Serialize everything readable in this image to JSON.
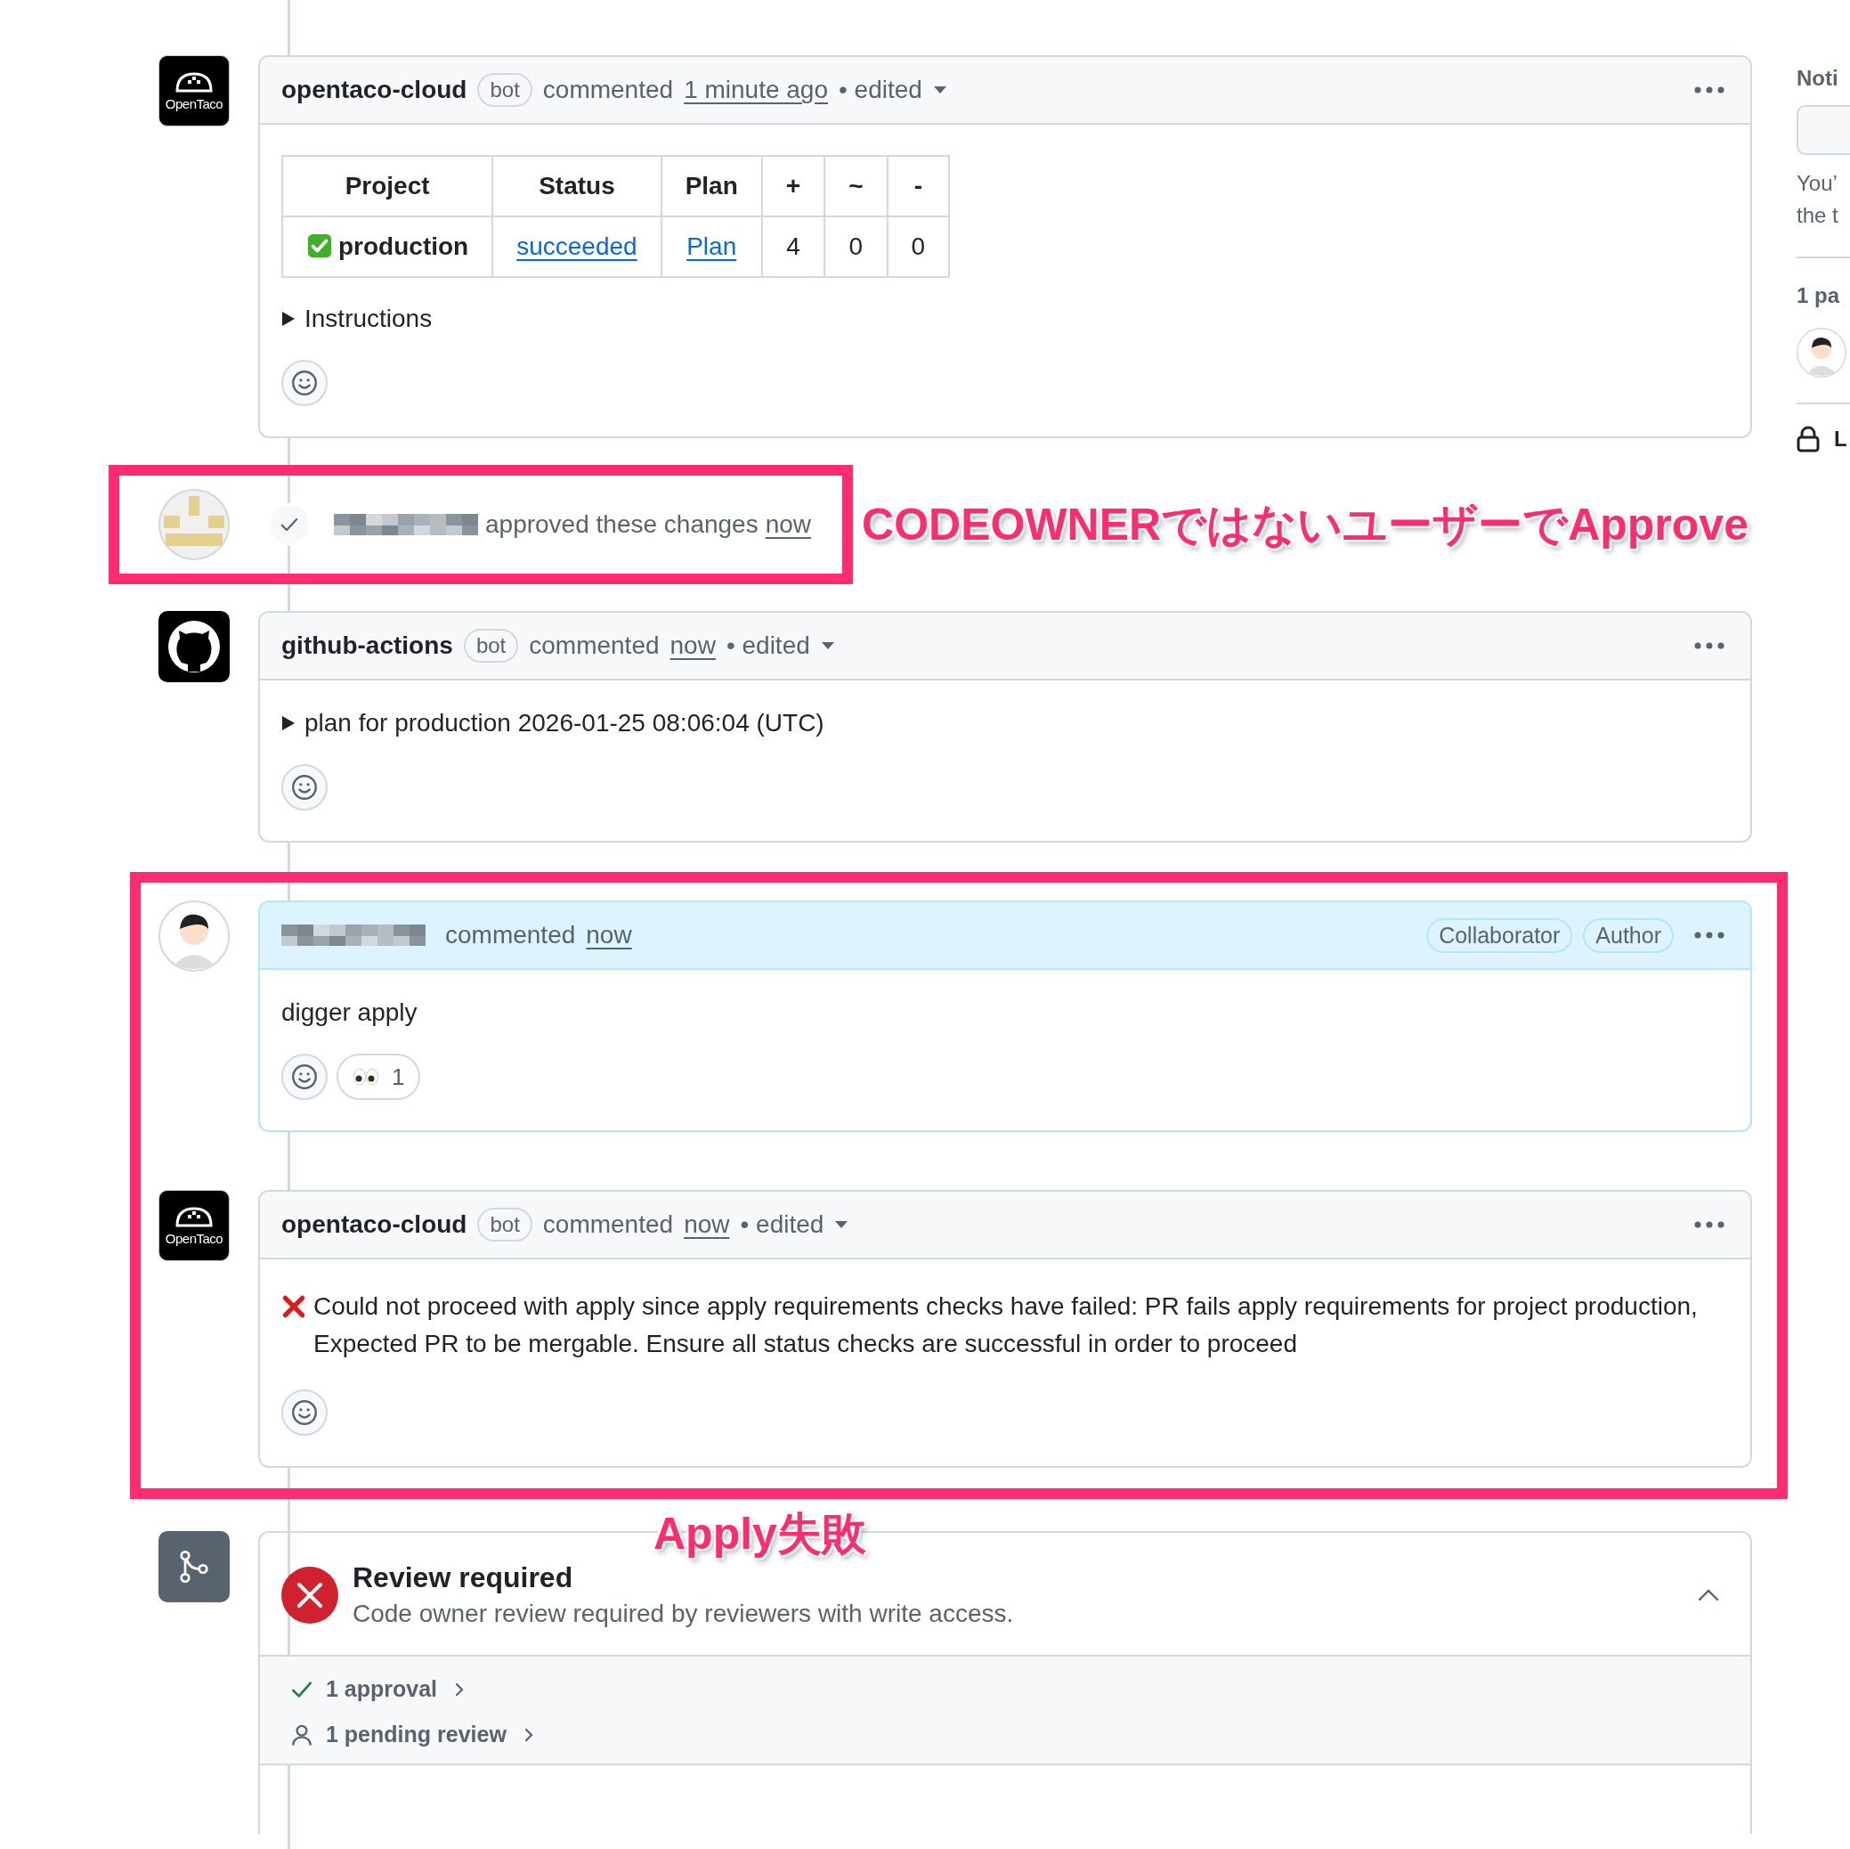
{
  "timeline": [
    {
      "kind": "comment",
      "avatar": {
        "kind": "logo",
        "text": "OpenTaco"
      },
      "author": "opentaco-cloud",
      "badge": "bot",
      "action": "commented",
      "time": "1 minute ago",
      "edited": "• edited",
      "highlighted": false,
      "body": [
        {
          "kind": "table",
          "columns": [
            "Project",
            "Status",
            "Plan",
            "+",
            "~",
            "-"
          ],
          "rows": [
            {
              "passed": true,
              "cells": [
                {
                  "text": "production",
                  "link": false
                },
                {
                  "text": "succeeded",
                  "link": true
                },
                {
                  "text": "Plan",
                  "link": true
                },
                {
                  "text": "4",
                  "link": false
                },
                {
                  "text": "0",
                  "link": false
                },
                {
                  "text": "0",
                  "link": false
                }
              ]
            }
          ]
        },
        {
          "kind": "details",
          "text": "Instructions",
          "expanded": false
        }
      ]
    },
    {
      "kind": "highlight",
      "note": "CODEOWNERではないユーザーでApprove",
      "note_beside": true,
      "items": [
        {
          "kind": "review",
          "avatar": {
            "kind": "identicon"
          },
          "redacted": true,
          "text": "approved these changes",
          "time": "now"
        }
      ]
    },
    {
      "kind": "comment",
      "avatar": {
        "kind": "octocat"
      },
      "author": "github-actions",
      "badge": "bot",
      "action": "commented",
      "time": "now",
      "edited": "• edited",
      "highlighted": false,
      "body": [
        {
          "kind": "details",
          "text": "plan for production 2026-01-25 08:06:04 (UTC)",
          "expanded": false
        }
      ]
    },
    {
      "kind": "highlight",
      "note": "Apply失敗",
      "note_beside": false,
      "items": [
        {
          "kind": "comment",
          "avatar": {
            "kind": "person"
          },
          "redacted": true,
          "action": "commented",
          "time": "now",
          "highlighted": true,
          "labels": [
            "Collaborator",
            "Author"
          ],
          "body": [
            {
              "kind": "text",
              "text": "digger apply"
            }
          ],
          "reactions": [
            {
              "kind": "eyes",
              "count": "1"
            }
          ]
        },
        {
          "kind": "comment",
          "avatar": {
            "kind": "logo",
            "text": "OpenTaco"
          },
          "author": "opentaco-cloud",
          "badge": "bot",
          "action": "commented",
          "time": "now",
          "edited": "• edited",
          "highlighted": false,
          "body": [
            {
              "kind": "error",
              "text": "Could not proceed with apply since apply requirements checks have failed: PR fails apply requirements for project production, Expected PR to be mergable. Ensure all status checks are successful in order to proceed"
            }
          ]
        }
      ]
    },
    {
      "kind": "merge_status",
      "title": "Review required",
      "description": "Code owner review required by reviewers with write access.",
      "failed": true,
      "expanded": true,
      "checks": [
        {
          "kind": "approved",
          "text": "1 approval"
        },
        {
          "kind": "pending",
          "text": "1 pending review"
        }
      ]
    }
  ],
  "sidebar": {
    "notifications": {
      "heading": "Noti",
      "lines": [
        "You’",
        "the t"
      ]
    },
    "participants": {
      "heading": "1 pa"
    },
    "lock": {
      "text": "L"
    }
  }
}
